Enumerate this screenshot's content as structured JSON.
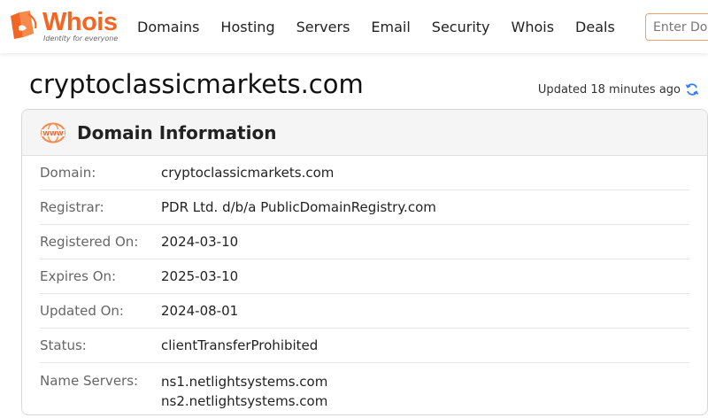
{
  "header": {
    "logo_text": "Whois",
    "logo_tagline": "Identity for everyone",
    "nav": [
      "Domains",
      "Hosting",
      "Servers",
      "Email",
      "Security",
      "Whois",
      "Deals"
    ],
    "search_placeholder": "Enter Domain"
  },
  "page": {
    "domain": "cryptoclassicmarkets.com",
    "updated": "Updated 18 minutes ago"
  },
  "card": {
    "title": "Domain Information",
    "rows": [
      {
        "label": "Domain:",
        "value": "cryptoclassicmarkets.com"
      },
      {
        "label": "Registrar:",
        "value": "PDR Ltd. d/b/a PublicDomainRegistry.com"
      },
      {
        "label": "Registered On:",
        "value": "2024-03-10"
      },
      {
        "label": "Expires On:",
        "value": "2025-03-10"
      },
      {
        "label": "Updated On:",
        "value": "2024-08-01"
      },
      {
        "label": "Status:",
        "value": "clientTransferProhibited"
      }
    ],
    "name_servers_label": "Name Servers:",
    "name_servers": [
      "ns1.netlightsystems.com",
      "ns2.netlightsystems.com"
    ]
  },
  "colors": {
    "brand": "#f26522",
    "refresh": "#2d7ff9"
  }
}
